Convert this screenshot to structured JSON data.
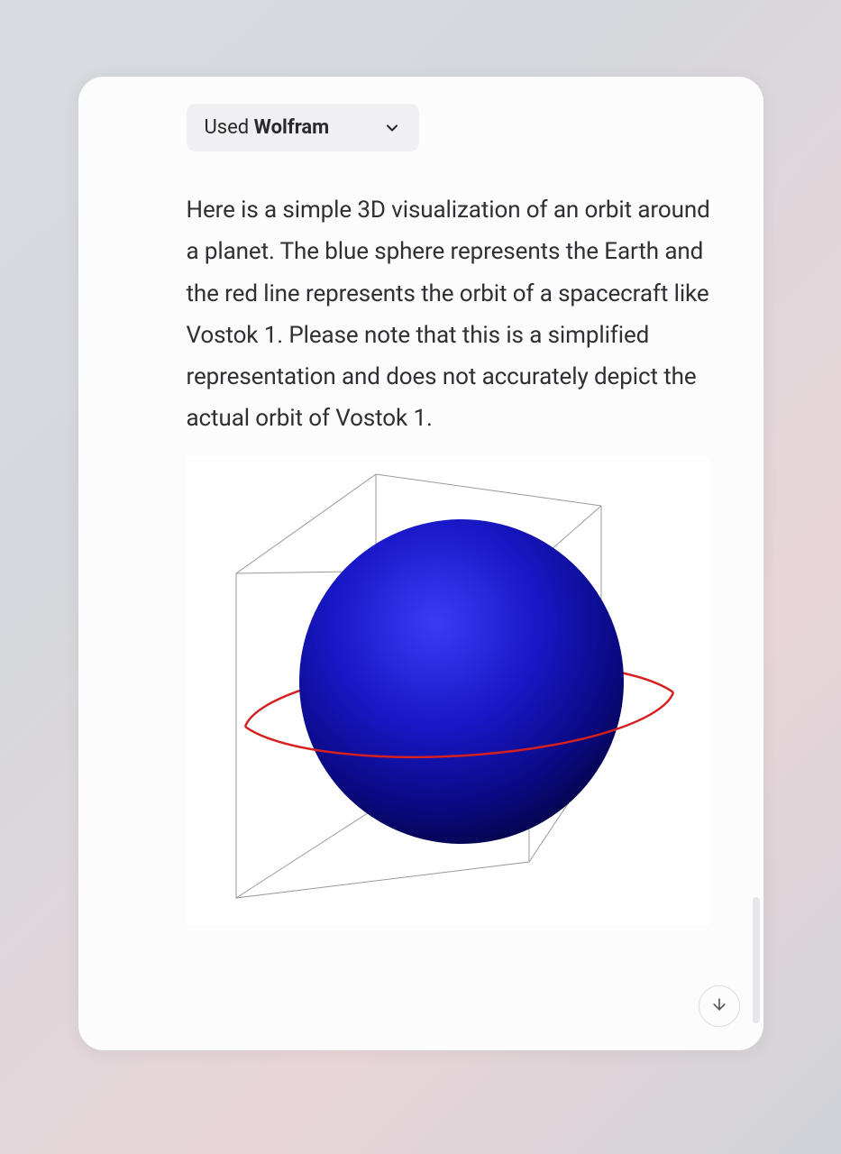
{
  "tool_chip": {
    "prefix": "Used ",
    "name": "Wolfram"
  },
  "message": {
    "body": "Here is a simple 3D visualization of an orbit around a planet. The blue sphere represents the Earth and the red line represents the orbit of a spacecraft like Vostok 1. Please note that this is a simplified representation and does not accurately depict the actual orbit of Vostok 1."
  },
  "visualization": {
    "planet_color": "#1818c8",
    "orbit_color": "#d52020",
    "box_color": "#888888"
  },
  "icons": {
    "chevron_down": "chevron-down-icon",
    "arrow_down": "arrow-down-icon"
  }
}
